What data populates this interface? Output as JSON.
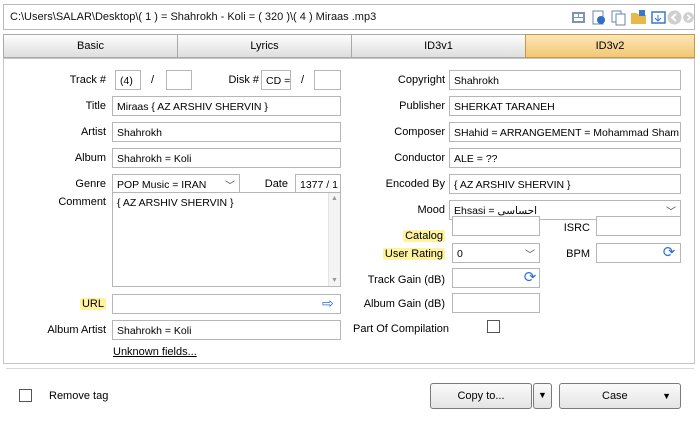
{
  "path_bar": {
    "text": "C:\\Users\\SALAR\\Desktop\\( 1 ) = Shahrokh - Koli = ( 320 )\\( 4 )  Miraas .mp3"
  },
  "tabs": [
    {
      "label": "Basic"
    },
    {
      "label": "Lyrics"
    },
    {
      "label": "ID3v1"
    },
    {
      "label": "ID3v2"
    }
  ],
  "left": {
    "track_label": "Track #",
    "track_value": "(4)",
    "track_total": "",
    "disk_label": "Disk #",
    "disk_value": "CD =",
    "disk_total": "",
    "title_label": "Title",
    "title_value": "Miraas  { AZ ARSHIV SHERVIN }",
    "artist_label": "Artist",
    "artist_value": "Shahrokh",
    "album_label": "Album",
    "album_value": "Shahrokh = Koli",
    "genre_label": "Genre",
    "genre_value": "POP Music = IRAN",
    "date_label": "Date",
    "date_value": "1377 / 1",
    "comment_label": "Comment",
    "comment_value": "{ AZ ARSHIV SHERVIN }",
    "url_label": "URL",
    "url_value": "",
    "album_artist_label": "Album Artist",
    "album_artist_value": "Shahrokh = Koli",
    "unknown_fields": "Unknown fields..."
  },
  "right": {
    "copyright_label": "Copyright",
    "copyright_value": "Shahrokh",
    "publisher_label": "Publisher",
    "publisher_value": "SHERKAT TARANEH",
    "composer_label": "Composer",
    "composer_value": "SHahid = ARRANGEMENT = Mohammad Sham",
    "conductor_label": "Conductor",
    "conductor_value": "ALE = ??",
    "encoded_label": "Encoded By",
    "encoded_value": "{ AZ ARSHIV SHERVIN }",
    "mood_label": "Mood",
    "mood_value": "Ehsasi = احساسی",
    "catalog_label": "Catalog",
    "catalog_value": "",
    "isrc_label": "ISRC",
    "isrc_value": "",
    "rating_label": "User Rating",
    "rating_value": "0",
    "bpm_label": "BPM",
    "bpm_value": "",
    "track_gain_label": "Track Gain (dB)",
    "track_gain_value": "",
    "album_gain_label": "Album Gain (dB)",
    "album_gain_value": "",
    "compilation_label": "Part Of Compilation"
  },
  "footer": {
    "remove_tag": "Remove tag",
    "copy_to": "Copy to...",
    "case": "Case"
  },
  "colors": {
    "highlight": "#fff3a0",
    "active_tab": "#f3c873",
    "refresh_icon": "#2d6fd1"
  }
}
